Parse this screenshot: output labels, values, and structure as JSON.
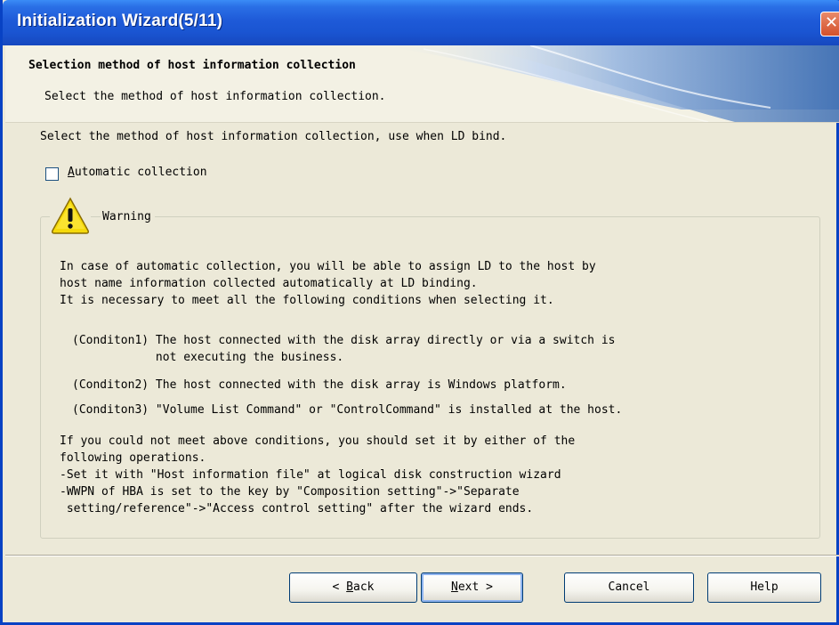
{
  "window": {
    "title": "Initialization Wizard(5/11)",
    "close_glyph": "✕"
  },
  "header": {
    "title": "Selection method of host information collection",
    "subtitle": "Select the method of host information collection."
  },
  "instruction": "Select the method of host information collection, use when LD bind.",
  "checkbox": {
    "mnemonic": "A",
    "label_rest": "utomatic collection",
    "checked": false
  },
  "warning": {
    "label": "Warning",
    "icon": "warning-icon",
    "intro": [
      "In case of automatic collection, you will be able to assign LD to the host by",
      "host name information collected automatically at LD binding.",
      "It is necessary to meet all the following conditions when selecting it."
    ],
    "conditions": [
      "(Conditon1) The host connected with the disk array directly or via a switch is",
      "            not executing the business.",
      "(Conditon2) The host connected with the disk array is Windows platform.",
      "(Conditon3) \"Volume List Command\" or \"ControlCommand\" is installed at the host."
    ],
    "outro": [
      "If you could not meet above conditions, you should set it by either of the",
      "following operations.",
      "-Set it with \"Host information file\" at logical disk construction wizard",
      "-WWPN of HBA is set to the key by \"Composition setting\"->\"Separate",
      " setting/reference\"->\"Access control setting\" after the wizard ends."
    ]
  },
  "buttons": {
    "back": {
      "prefix": "< ",
      "mnemonic": "B",
      "rest": "ack"
    },
    "next": {
      "mnemonic": "N",
      "rest": "ext >"
    },
    "cancel": "Cancel",
    "help": "Help"
  },
  "colors": {
    "title_bar": "#1a55d2",
    "dialog_bg": "#ece9d8",
    "button_border": "#003c74",
    "warning_yellow": "#f5d90a"
  }
}
